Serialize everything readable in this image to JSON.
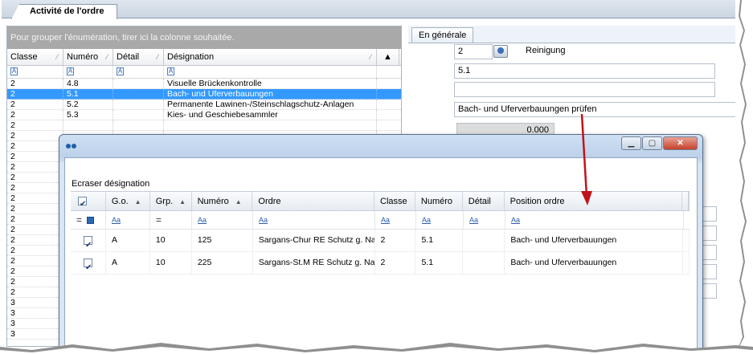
{
  "window": {
    "main_tab": "Activité de l'ordre"
  },
  "left_grid": {
    "group_hint": "Pour grouper l'énumération, tirer ici la colonne souhaitée.",
    "columns": [
      "Classe",
      "Numéro",
      "Détail",
      "Désignation"
    ],
    "rows": [
      {
        "classe": "2",
        "numero": "4.8",
        "detail": "",
        "designation": "Visuelle Brückenkontrolle"
      },
      {
        "classe": "2",
        "numero": "5.1",
        "detail": "",
        "designation": "Bach- und Uferverbauungen",
        "selected": true
      },
      {
        "classe": "2",
        "numero": "5.2",
        "detail": "",
        "designation": "Permanente Lawinen-/Steinschlagschutz-Anlagen"
      },
      {
        "classe": "2",
        "numero": "5.3",
        "detail": "",
        "designation": "Kies- und Geschiebesammler"
      },
      {
        "classe": "2",
        "numero": "",
        "detail": "",
        "designation": ""
      },
      {
        "classe": "2",
        "numero": "",
        "detail": "",
        "designation": ""
      },
      {
        "classe": "2",
        "numero": "",
        "detail": "",
        "designation": ""
      },
      {
        "classe": "2",
        "numero": "",
        "detail": "",
        "designation": ""
      },
      {
        "classe": "2",
        "numero": "",
        "detail": "",
        "designation": ""
      },
      {
        "classe": "2",
        "numero": "",
        "detail": "",
        "designation": ""
      },
      {
        "classe": "2",
        "numero": "",
        "detail": "",
        "designation": ""
      },
      {
        "classe": "2",
        "numero": "",
        "detail": "",
        "designation": ""
      },
      {
        "classe": "2",
        "numero": "",
        "detail": "",
        "designation": ""
      },
      {
        "classe": "2",
        "numero": "",
        "detail": "",
        "designation": ""
      },
      {
        "classe": "2",
        "numero": "",
        "detail": "",
        "designation": ""
      },
      {
        "classe": "2",
        "numero": "",
        "detail": "",
        "designation": ""
      },
      {
        "classe": "2",
        "numero": "",
        "detail": "",
        "designation": ""
      },
      {
        "classe": "2",
        "numero": "",
        "detail": "",
        "designation": ""
      },
      {
        "classe": "2",
        "numero": "",
        "detail": "",
        "designation": ""
      },
      {
        "classe": "2",
        "numero": "",
        "detail": "",
        "designation": ""
      },
      {
        "classe": "2",
        "numero": "",
        "detail": "",
        "designation": ""
      },
      {
        "classe": "3",
        "numero": "",
        "detail": "",
        "designation": ""
      },
      {
        "classe": "3",
        "numero": "",
        "detail": "",
        "designation": ""
      },
      {
        "classe": "3",
        "numero": "",
        "detail": "",
        "designation": ""
      },
      {
        "classe": "3",
        "numero": "",
        "detail": "",
        "designation": ""
      }
    ]
  },
  "right_panel": {
    "tab": "En générale",
    "class_value": "2",
    "class_name": "Reinigung",
    "number_value": "5.1",
    "detail_value": "",
    "designation_value": "Bach- und Uferverbauungen prüfen",
    "amount_value": "0.000"
  },
  "dialog": {
    "caption": "Ecraser désignation",
    "columns": [
      "G.o.",
      "Grp.",
      "Numéro",
      "Ordre",
      "Classe",
      "Numéro",
      "Détail",
      "Position ordre"
    ],
    "filter_glyph": "Aa",
    "rows": [
      {
        "checked": true,
        "go": "A",
        "grp": "10",
        "numero": "125",
        "ordre": "Sargans-Chur RE Schutz g. Nat.",
        "classe": "2",
        "numero2": "5.1",
        "detail": "",
        "position": "Bach- und Uferverbauungen"
      },
      {
        "checked": true,
        "go": "A",
        "grp": "10",
        "numero": "225",
        "ordre": "Sargans-St.M RE Schutz g. Nat.",
        "classe": "2",
        "numero2": "5.1",
        "detail": "",
        "position": "Bach- und Uferverbauungen"
      }
    ]
  },
  "colors": {
    "selection": "#3399ff",
    "arrow": "#c0141b",
    "group_bar": "#a9a9a9"
  }
}
